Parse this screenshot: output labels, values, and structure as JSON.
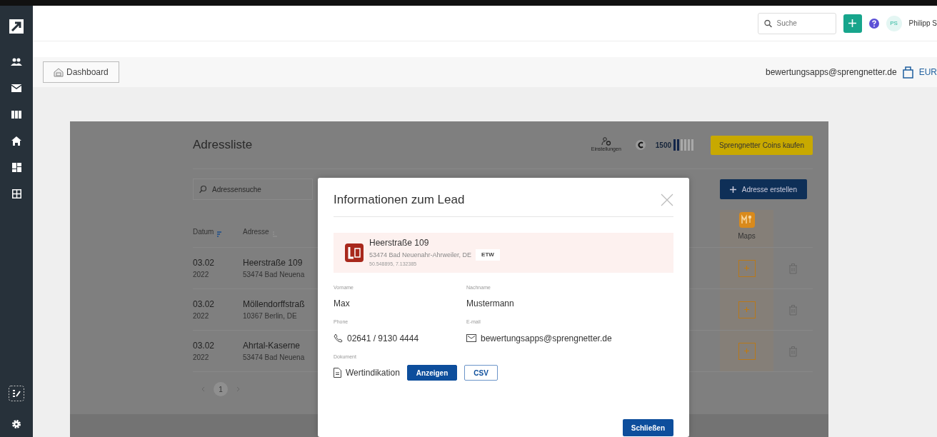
{
  "topbar": {
    "search": {
      "placeholder": "Suche"
    },
    "avatar": "PS",
    "user": "Philipp S"
  },
  "subbar": {
    "dashboard_button": "Dashboard",
    "email": "bewertungsapps@sprengnetter.de",
    "currency": "EUR"
  },
  "app": {
    "title": "Adressliste",
    "settings_label": "Einstellungen",
    "coins": "1500",
    "coin_meter": {
      "level": 0.33
    },
    "buy_button": "Sprengnetter Coins kaufen",
    "search": {
      "placeholder": "Adressensuche"
    },
    "create_button": "Adresse erstellen",
    "columns": [
      "Datum",
      "Adresse"
    ],
    "maps_column": "Maps",
    "rows": [
      {
        "date": "03.02",
        "year": "2022",
        "street": "Heerstraße 109",
        "city": "53474 Bad Neuena"
      },
      {
        "date": "03.02",
        "year": "2022",
        "street": "Möllendorffstraß",
        "city": "10367 Berlin, DE"
      },
      {
        "date": "03.02",
        "year": "2022",
        "street": "Ahrtal-Kaserne",
        "city": "53474 Bad Neuena"
      }
    ],
    "pagination": [
      {
        "label": "1",
        "selected": true
      }
    ]
  },
  "modal": {
    "title": "Informationen zum Lead",
    "property": {
      "street": "Heerstraße 109",
      "city": "53474 Bad Neuenahr-Ahrweiler, DE",
      "tag": "ETW",
      "coords": "50.548895, 7.132385"
    },
    "fields": [
      {
        "label": "Vorname",
        "value": "Max",
        "kind": "text"
      },
      {
        "label": "Nachname",
        "value": "Mustermann",
        "kind": "text"
      },
      {
        "label": "Phone",
        "value": "02641 / 9130 4444",
        "kind": "phone"
      },
      {
        "label": "E-mail",
        "value": "bewertungsapps@sprengnetter.de",
        "kind": "email"
      }
    ],
    "document": {
      "label": "Dokument",
      "name": "Wertindikation",
      "buttons": [
        {
          "label": "Anzeigen",
          "kind": "primary"
        },
        {
          "label": "CSV",
          "kind": "outline"
        }
      ]
    },
    "close_button": "Schließen"
  }
}
